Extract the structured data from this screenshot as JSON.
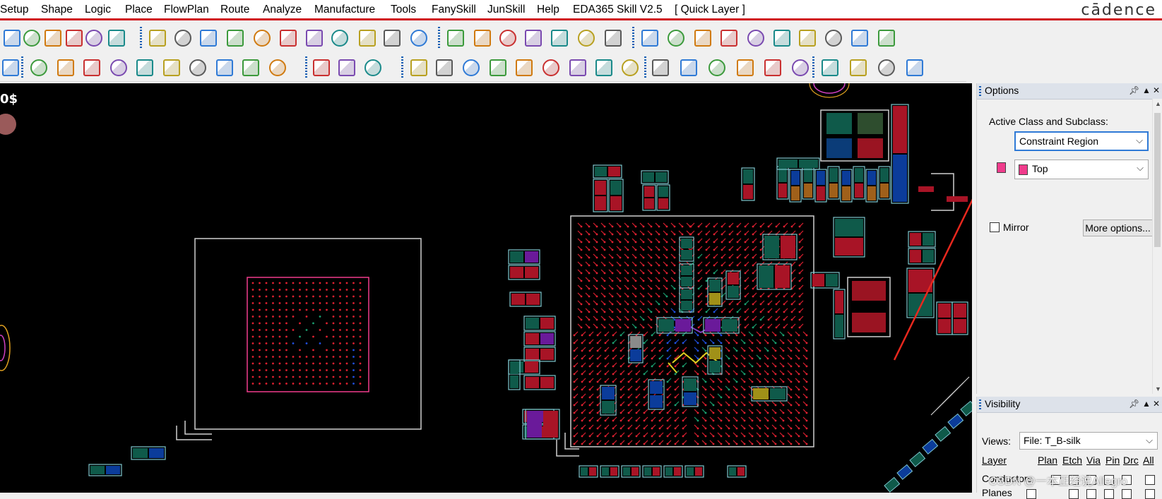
{
  "menubar": {
    "items": [
      "Setup",
      "Shape",
      "Logic",
      "Place",
      "FlowPlan",
      "Route",
      "Analyze",
      "Manufacture",
      "Tools",
      "FanySkill",
      "JunSkill",
      "Help",
      "EDA365 Skill V2.5",
      "[ Quick Layer ]"
    ],
    "brand": "cādence"
  },
  "options_panel": {
    "title": "Options",
    "active_class_label": "Active Class and Subclass:",
    "class_value": "Constraint Region",
    "subclass_value": "Top",
    "mirror_label": "Mirror",
    "mirror_checked": false,
    "more_options_label": "More options..."
  },
  "visibility_panel": {
    "title": "Visibility",
    "views_label": "Views:",
    "views_value": "File: T_B-silk",
    "columns": [
      "Layer",
      "Plan",
      "Etch",
      "Via",
      "Pin",
      "Drc",
      "All"
    ],
    "rows": [
      "Conductors",
      "Planes"
    ]
  },
  "watermark": "CSDN @一本正经说Allegro",
  "colors": {
    "accent_red": "#d0141c",
    "subclass_swatch": "#f03c8c",
    "focus_border": "#2f7ad6",
    "annotation_arrow": "#e8281e"
  }
}
